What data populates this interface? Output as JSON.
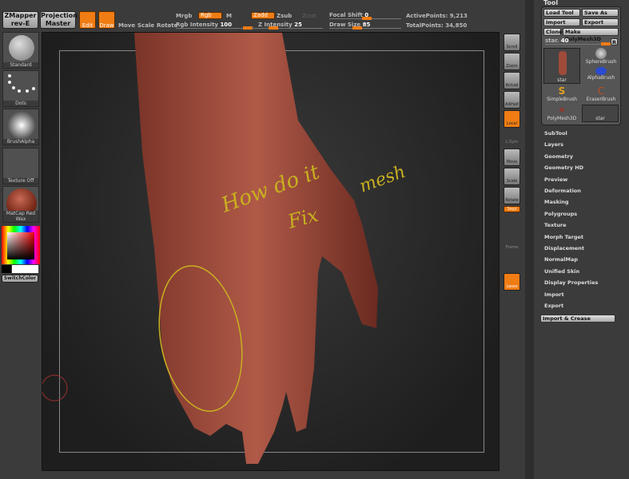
{
  "topbar": {
    "zmapper": "ZMapper",
    "zmapper_sub": "rev-E",
    "projection": "Projection",
    "projection_sub": "Master",
    "edit": "Edit",
    "draw": "Draw",
    "move": "Move",
    "scale": "Scale",
    "rotate": "Rotate",
    "mrgb": "Mrgb",
    "rgb": "Rgb",
    "m": "M",
    "zadd": "Zadd",
    "zsub": "Zsub",
    "zcut": "Zcut",
    "rgb_intensity_label": "Rgb Intensity",
    "rgb_intensity": "100",
    "z_intensity_label": "Z Intensity",
    "z_intensity": "25",
    "focal_shift_label": "Focal Shift",
    "focal_shift": "0",
    "draw_size_label": "Draw Size",
    "draw_size": "85",
    "active_points": "ActivePoints: 9,213",
    "total_points": "TotalPoints: 34,850"
  },
  "left": {
    "tiles": [
      "Standard",
      "Dots",
      "BrushAlpha",
      "Texture Off",
      "MatCap Red Wax"
    ],
    "switch_color": "SwitchColor"
  },
  "right_toolbar": [
    "Scroll",
    "Zoom",
    "Actual",
    "AAHalf",
    "Local",
    "L.Sym",
    "Move",
    "Scale",
    "Rotate",
    "Sxyz",
    "Frame",
    "Lasso"
  ],
  "tool_panel": {
    "title": "Tool",
    "load_tool": "Load Tool",
    "save_as": "Save As",
    "import": "Import",
    "export": "Export",
    "clone": "Clone",
    "make_polymesh": "Make PolyMesh3D",
    "slider_label": "star.",
    "slider_value": "40",
    "r": "R",
    "brushes": [
      "star",
      "SphereBrush",
      "AlphaBrush",
      "SimpleBrush",
      "EraserBrush",
      "PolyMesh3D",
      "star"
    ]
  },
  "menu": [
    "SubTool",
    "Layers",
    "Geometry",
    "Geometry HD",
    "Preview",
    "Deformation",
    "Masking",
    "Polygroups",
    "Texture",
    "Morph Target",
    "Displacement",
    "NormalMap",
    "Unified Skin",
    "Display Properties",
    "Import",
    "Export"
  ],
  "import_crease": "Import & Crease",
  "annotation": {
    "line1": "How do it",
    "line2": "Fix",
    "line3": "mesh"
  },
  "colors": {
    "accent": "#f07c14",
    "annotation": "#c8b020",
    "skin": "#9a4436"
  }
}
